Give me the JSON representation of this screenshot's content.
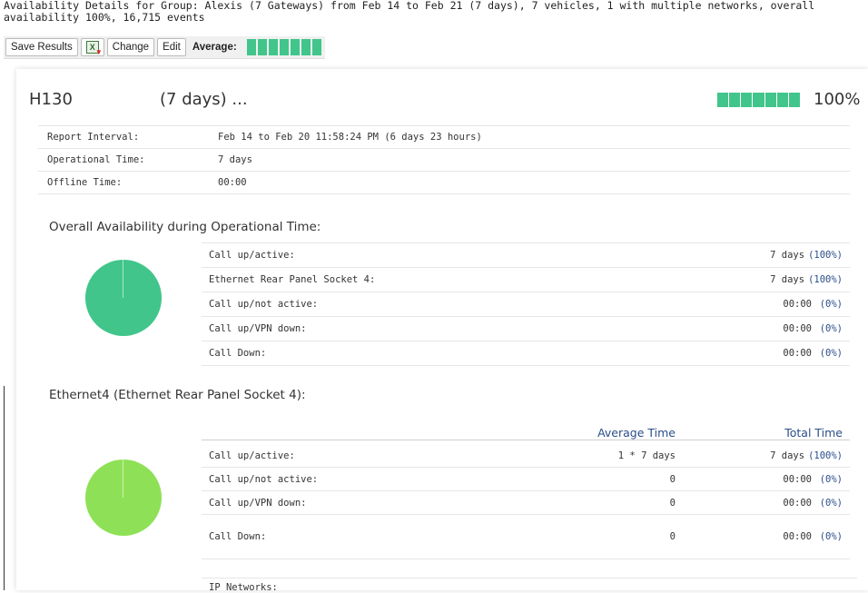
{
  "header": {
    "summary": "Availability Details for Group: Alexis (7 Gateways) from Feb 14 to Feb 21 (7 days), 7 vehicles, 1 with multiple networks, overall availability 100%, 16,715 events"
  },
  "toolbar": {
    "save_results": "Save Results",
    "export_icon": "excel-export-icon",
    "change": "Change",
    "edit": "Edit",
    "average_label": "Average:",
    "average_value": 1.0
  },
  "vehicle": {
    "name": "H130",
    "days": "(7 days) ...",
    "availability_pct": "100%",
    "availability_value": 1.0
  },
  "info": [
    {
      "label": "Report Interval:",
      "value": "Feb 14 to Feb 20 11:58:24 PM (6 days 23 hours)"
    },
    {
      "label": "Operational Time:",
      "value": "7 days"
    },
    {
      "label": "Offline Time:",
      "value": "00:00"
    }
  ],
  "overall": {
    "title": "Overall Availability during Operational Time:",
    "pie_color": "#41c58b",
    "rows": [
      {
        "label": "Call up/active:",
        "time": "7 days",
        "pct": "(100%)"
      },
      {
        "label": "Ethernet Rear Panel Socket 4:",
        "time": "7 days",
        "pct": "(100%)"
      },
      {
        "label": "Call up/not active:",
        "time": "00:00",
        "pct": "(0%)"
      },
      {
        "label": "Call up/VPN down:",
        "time": "00:00",
        "pct": "(0%)"
      },
      {
        "label": "Call Down:",
        "time": "00:00",
        "pct": "(0%)"
      }
    ]
  },
  "ethernet": {
    "title": "Ethernet4 (Ethernet Rear Panel Socket 4):",
    "pie_color": "#8ee156",
    "col_avg": "Average Time",
    "col_total": "Total Time",
    "rows": [
      {
        "label": "Call up/active:",
        "avg": "1 * 7 days",
        "time": "7 days",
        "pct": "(100%)"
      },
      {
        "label": "Call up/not active:",
        "avg": "0",
        "time": "00:00",
        "pct": "(0%)"
      },
      {
        "label": "Call up/VPN down:",
        "avg": "0",
        "time": "00:00",
        "pct": "(0%)"
      },
      {
        "label": "Call Down:",
        "avg": "0",
        "time": "00:00",
        "pct": "(0%)"
      }
    ],
    "ip_networks_label": "IP Networks:"
  },
  "colors": {
    "availability_green": "#41c58b",
    "ethernet_green": "#8ee156",
    "accent_blue": "#2b4e8a"
  }
}
